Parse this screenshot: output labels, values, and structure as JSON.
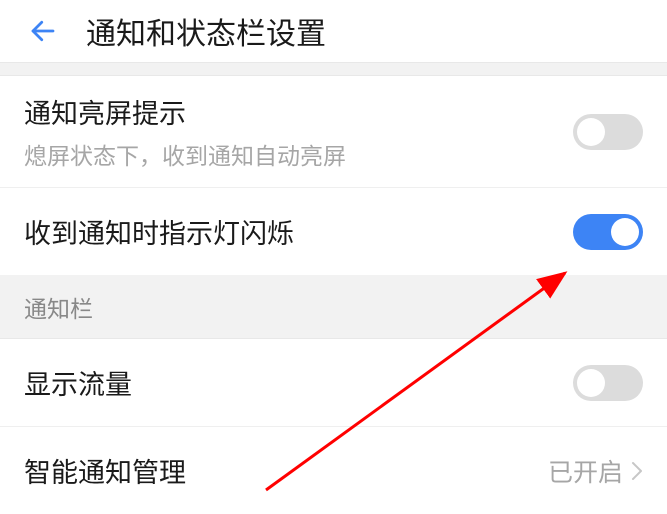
{
  "header": {
    "title": "通知和状态栏设置"
  },
  "rows": {
    "wake_on_notice": {
      "title": "通知亮屏提示",
      "subtitle": "熄屏状态下，收到通知自动亮屏",
      "enabled": false
    },
    "led_blink": {
      "title": "收到通知时指示灯闪烁",
      "enabled": true
    },
    "show_data_usage": {
      "title": "显示流量",
      "enabled": false
    },
    "smart_notice": {
      "title": "智能通知管理",
      "value": "已开启"
    }
  },
  "sections": {
    "notice_bar": "通知栏"
  },
  "colors": {
    "accent": "#3d84f5",
    "annotation": "#ff0000"
  }
}
